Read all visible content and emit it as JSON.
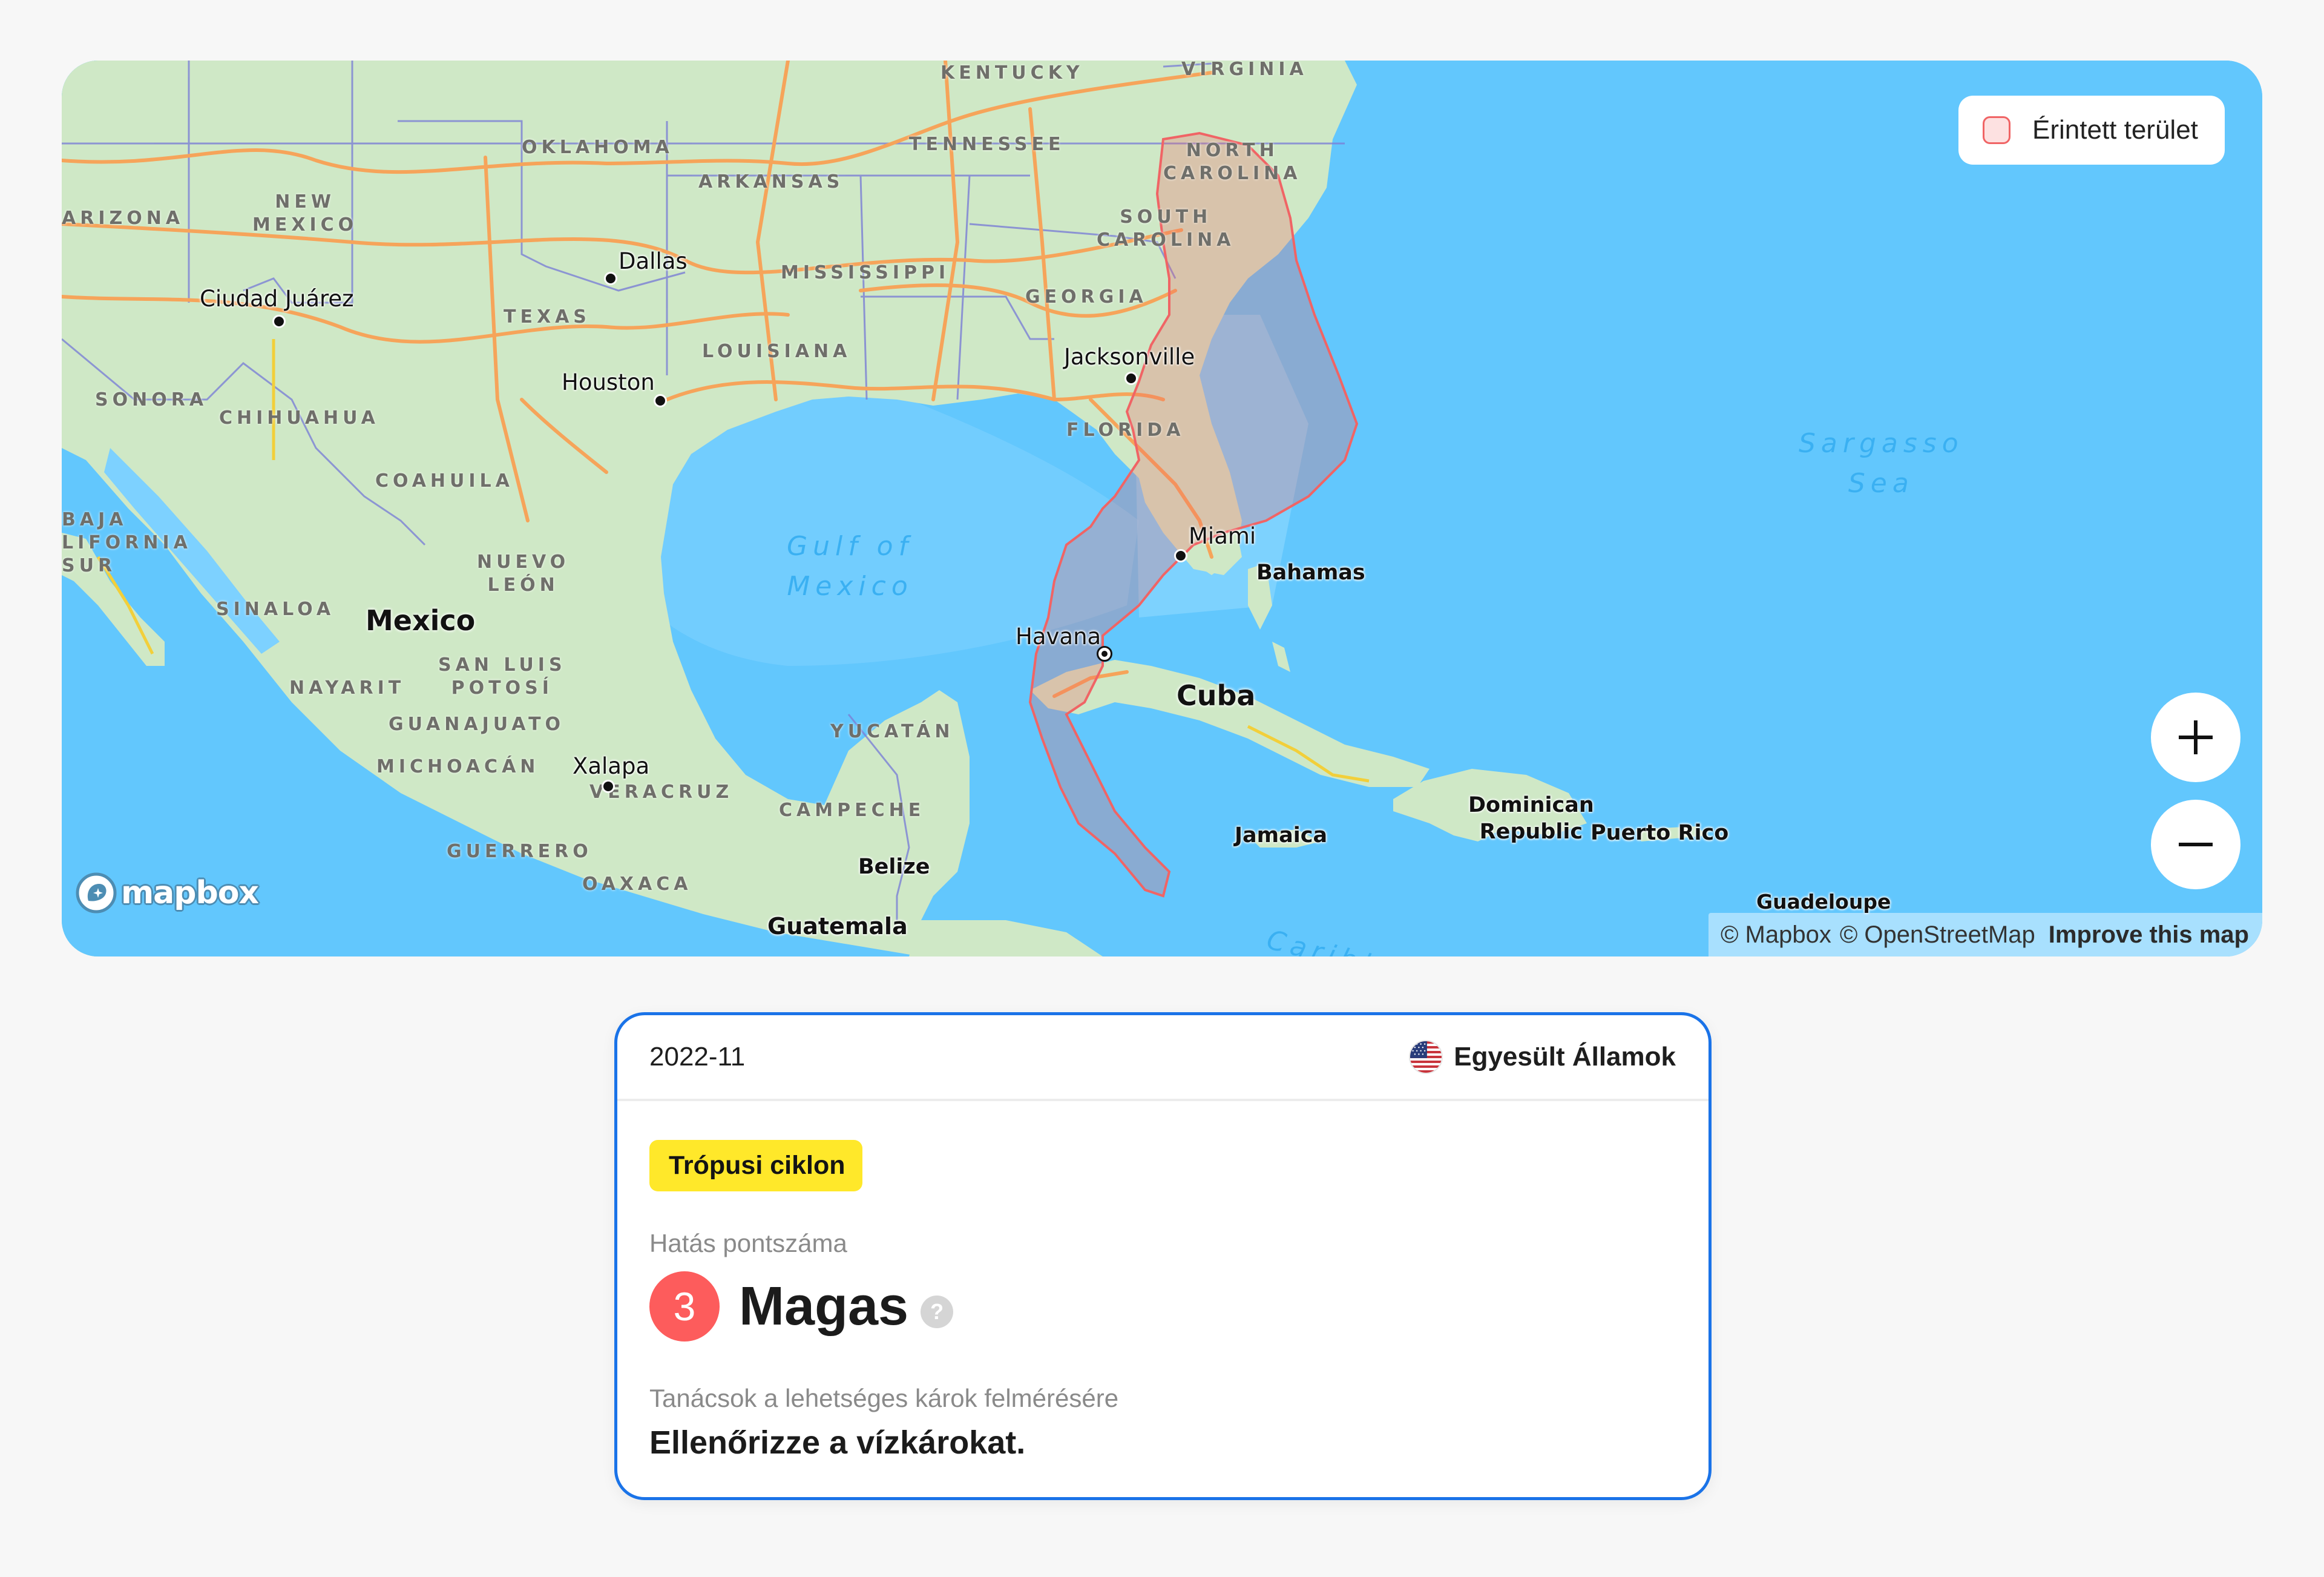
{
  "map": {
    "legend": {
      "label": "Érintett terület",
      "swatch_fill": "#fde1e1",
      "swatch_border": "#f06465"
    },
    "zoom_in_icon": "plus-icon",
    "zoom_out_icon": "minus-icon",
    "logo_text": "mapbox",
    "attribution": {
      "mapbox": "© Mapbox",
      "osm": "© OpenStreetMap",
      "improve": "Improve this map"
    },
    "affected_area_color": "#f06465",
    "labels": {
      "states": {
        "kentucky": "KENTUCKY",
        "virginia": "VIRGINIA",
        "oklahoma": "OKLAHOMA",
        "tennessee": "TENNESSEE",
        "arkansas": "ARKANSAS",
        "north_carolina": "NORTH\nCAROLINA",
        "south_carolina": "SOUTH\nCAROLINA",
        "arizona": "ARIZONA",
        "new_mexico": "NEW\nMEXICO",
        "mississippi": "MISSISSIPPI",
        "georgia": "GEORGIA",
        "texas": "TEXAS",
        "louisiana": "LOUISIANA",
        "florida": "FLORIDA",
        "sonora": "SONORA",
        "chihuahua": "CHIHUAHUA",
        "coahuila": "COAHUILA",
        "baja": "BAJA\nLIFORNIA\nSUR",
        "nuevo_leon": "NUEVO\nLEÓN",
        "sinaloa": "SINALOA",
        "san_luis": "SAN LUIS\nPOTOSÍ",
        "nayarit": "NAYARIT",
        "guanajuato": "GUANAJUATO",
        "michoacan": "MICHOACÁN",
        "veracruz": "VERACRUZ",
        "guerrero": "GUERRERO",
        "oaxaca": "OAXACA",
        "yucatan": "YUCATÁN",
        "campeche": "CAMPECHE"
      },
      "cities": {
        "dallas": "Dallas",
        "ciudad_juarez": "Ciudad Juárez",
        "houston": "Houston",
        "jacksonville": "Jacksonville",
        "miami": "Miami",
        "havana": "Havana",
        "xalapa": "Xalapa",
        "bahamas": "Bahamas",
        "jamaica": "Jamaica",
        "dominican": "Dominican\nRepublic",
        "puerto_rico": "Puerto Rico",
        "guadeloupe": "Guadeloupe",
        "belize": "Belize",
        "guatemala": "Guatemala"
      },
      "countries": {
        "mexico": "Mexico",
        "cuba": "Cuba"
      },
      "seas": {
        "gulf": "Gulf of\nMexico",
        "sargasso": "Sargasso\nSea",
        "caribbean": "Caribbean"
      }
    }
  },
  "card": {
    "date": "2022-11",
    "country": {
      "name": "Egyesült Államok",
      "flag_icon": "us-flag-icon"
    },
    "event_type": "Trópusi ciklon",
    "event_type_color": "#ffe82a",
    "impact_label": "Hatás pontszáma",
    "impact_score": "3",
    "impact_level": "Magas",
    "impact_color": "#fd5c5c",
    "help_icon": "?",
    "advice_label": "Tanácsok a lehetséges károk felmérésére",
    "advice_text": "Ellenőrizze a vízkárokat.",
    "border_color": "#1a73e8"
  }
}
